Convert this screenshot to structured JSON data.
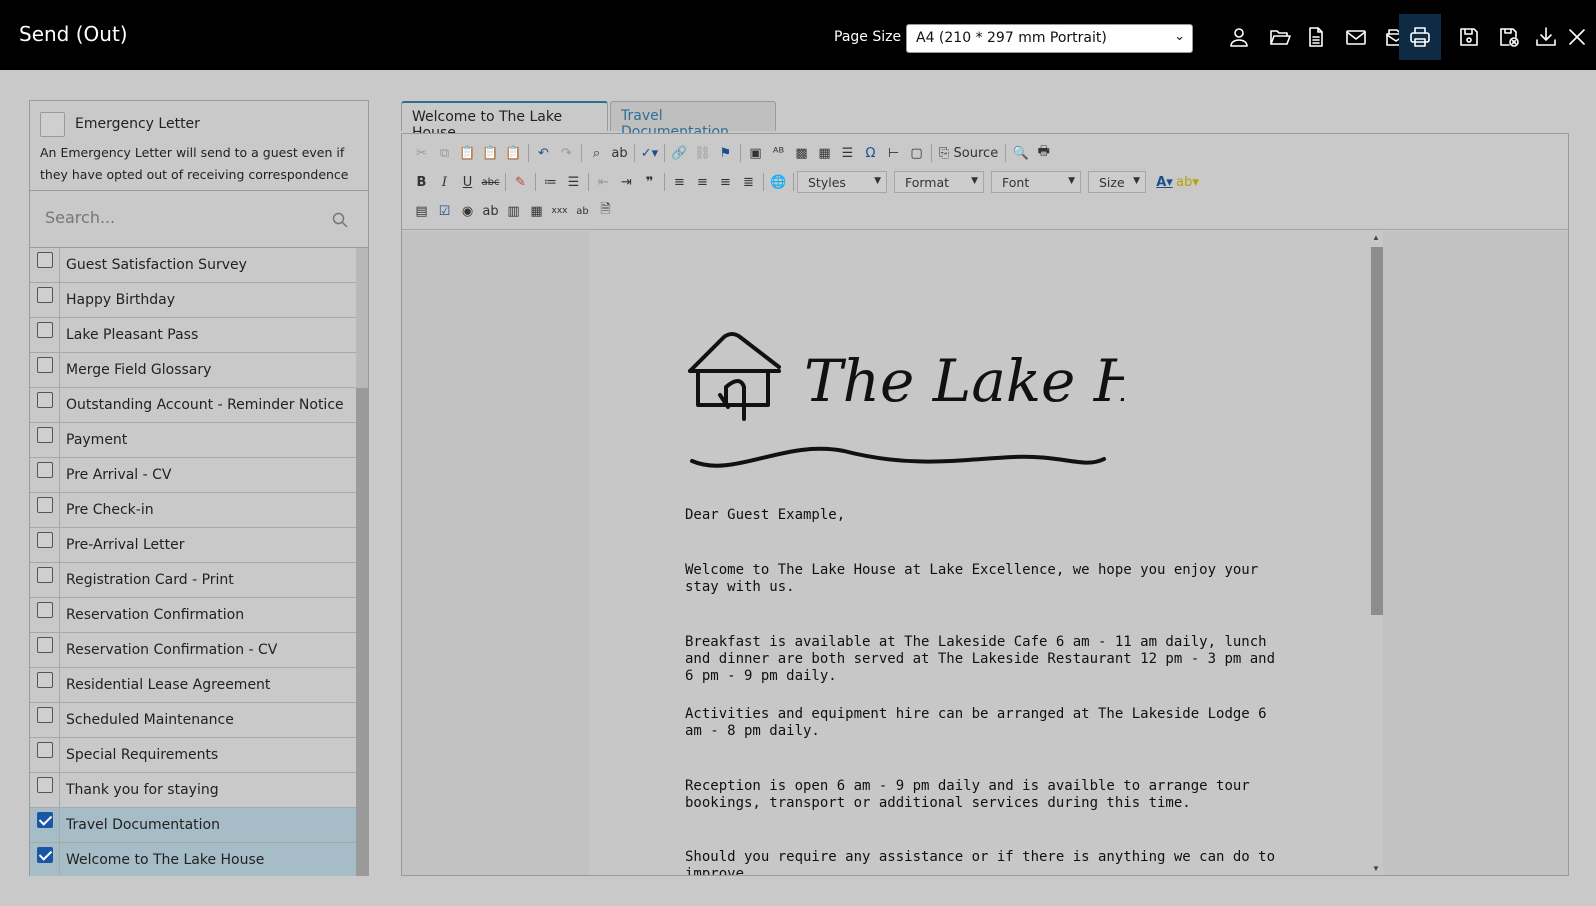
{
  "app": {
    "title": "Send (Out)"
  },
  "header": {
    "page_size_label": "Page Size",
    "page_size_value": "A4 (210 * 297 mm Portrait)",
    "buttons": [
      {
        "name": "guest-icon"
      },
      {
        "name": "folder-open-icon"
      },
      {
        "name": "document-icon"
      },
      {
        "name": "email-icon"
      },
      {
        "name": "email-folder-icon"
      },
      {
        "name": "print-icon"
      },
      {
        "name": "save-icon"
      },
      {
        "name": "save-close-icon"
      },
      {
        "name": "download-icon"
      },
      {
        "name": "close-icon"
      }
    ]
  },
  "sidebar": {
    "emergency_label": "Emergency Letter",
    "emergency_desc": "An Emergency Letter will send to a guest even if they have opted out of receiving correspondence",
    "emergency_checked": false,
    "search_placeholder": "Search...",
    "items": [
      {
        "label": "Guest Satisfaction Survey",
        "checked": false
      },
      {
        "label": "Happy Birthday",
        "checked": false
      },
      {
        "label": "Lake Pleasant Pass",
        "checked": false
      },
      {
        "label": "Merge Field Glossary",
        "checked": false
      },
      {
        "label": "Outstanding Account - Reminder Notice",
        "checked": false
      },
      {
        "label": "Payment",
        "checked": false
      },
      {
        "label": "Pre Arrival - CV",
        "checked": false
      },
      {
        "label": "Pre Check-in",
        "checked": false
      },
      {
        "label": "Pre-Arrival Letter",
        "checked": false
      },
      {
        "label": "Registration Card - Print",
        "checked": false
      },
      {
        "label": "Reservation Confirmation",
        "checked": false
      },
      {
        "label": "Reservation Confirmation - CV",
        "checked": false
      },
      {
        "label": "Residential Lease Agreement",
        "checked": false
      },
      {
        "label": "Scheduled Maintenance",
        "checked": false
      },
      {
        "label": "Special Requirements",
        "checked": false
      },
      {
        "label": "Thank you for staying",
        "checked": false
      },
      {
        "label": "Travel Documentation",
        "checked": true
      },
      {
        "label": "Welcome to The Lake House",
        "checked": true
      }
    ]
  },
  "tabs": [
    {
      "label": "Welcome to The Lake House",
      "active": true
    },
    {
      "label": "Travel Documentation",
      "active": false
    }
  ],
  "editor": {
    "toolbar": {
      "source_label": "Source",
      "styles": "Styles",
      "format": "Format",
      "font": "Font",
      "size": "Size"
    },
    "logo_text": "The Lake House.",
    "letter": {
      "greeting": "Dear Guest Example,",
      "paragraphs": [
        "Welcome to The Lake House at Lake Excellence, we hope you enjoy your stay with us.",
        "Breakfast is available at The Lakeside Cafe 6 am - 11 am daily, lunch and dinner are both served at The Lakeside Restaurant 12 pm - 3 pm and 6 pm - 9 pm daily.",
        "Activities and equipment hire can be arranged at The Lakeside Lodge 6 am - 8 pm daily.",
        "Reception is open 6 am - 9 pm daily and is availble to arrange tour bookings, transport or additional services during this time.",
        "Should you require any assistance or if there is anything we can do to improve"
      ]
    }
  },
  "colors": {
    "topbar": "#000000",
    "background": "#c9c9c9",
    "selected_row": "#a6bcc7",
    "checkbox_checked": "#1a56a6",
    "tab_text": "#2f6e99"
  }
}
